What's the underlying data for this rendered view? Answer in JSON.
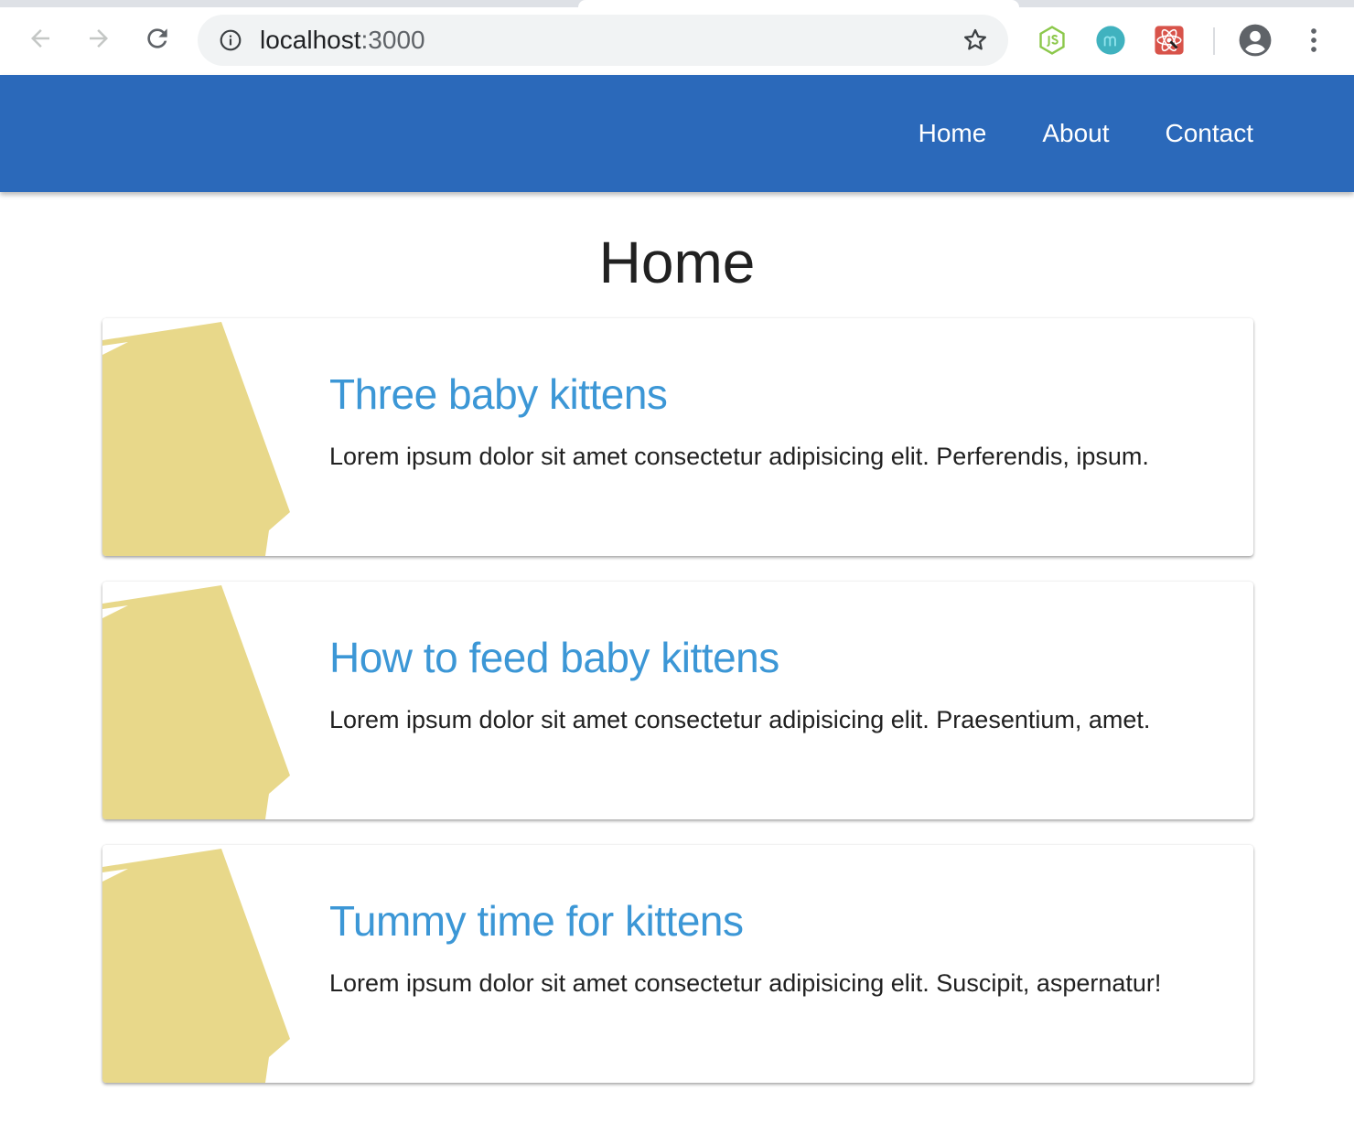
{
  "browser": {
    "url_host": "localhost",
    "url_port": ":3000",
    "extensions": [
      "nodejs-icon",
      "mercury-icon",
      "react-devtools-icon"
    ]
  },
  "nav": {
    "links": [
      {
        "label": "Home"
      },
      {
        "label": "About"
      },
      {
        "label": "Contact"
      }
    ]
  },
  "page": {
    "title": "Home"
  },
  "posts": [
    {
      "title": "Three baby kittens",
      "excerpt": "Lorem ipsum dolor sit amet consectetur adipisicing elit. Perferendis, ipsum."
    },
    {
      "title": "How to feed baby kittens",
      "excerpt": "Lorem ipsum dolor sit amet consectetur adipisicing elit. Praesentium, amet."
    },
    {
      "title": "Tummy time for kittens",
      "excerpt": "Lorem ipsum dolor sit amet consectetur adipisicing elit. Suscipit, aspernatur!"
    }
  ],
  "colors": {
    "header": "#2b69ba",
    "link_title": "#3c97d6",
    "thumbnail": "#e8d88a"
  }
}
